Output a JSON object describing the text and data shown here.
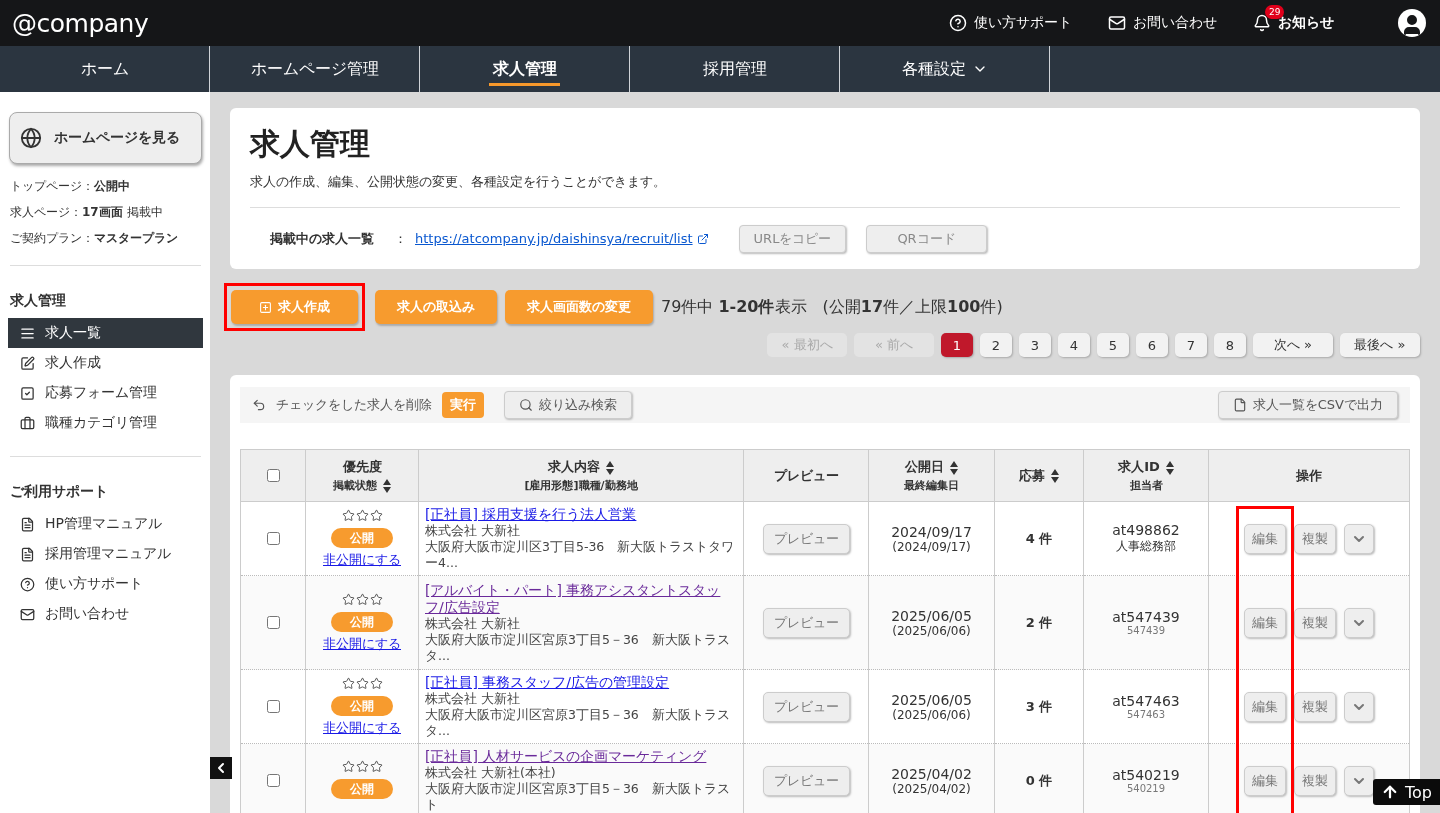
{
  "header": {
    "logo": "@company",
    "links": [
      {
        "kind": "help",
        "label": "使い方サポート"
      },
      {
        "kind": "mail",
        "label": "お問い合わせ"
      },
      {
        "kind": "bell",
        "label": "お知らせ",
        "badge": "29"
      }
    ]
  },
  "nav": [
    {
      "label": "ホーム",
      "selected": false,
      "dropdown": false
    },
    {
      "label": "ホームページ管理",
      "selected": false,
      "dropdown": false
    },
    {
      "label": "求人管理",
      "selected": true,
      "dropdown": false
    },
    {
      "label": "採用管理",
      "selected": false,
      "dropdown": false
    },
    {
      "label": "各種設定",
      "selected": false,
      "dropdown": true
    }
  ],
  "sidebar": {
    "view_button": "ホームページを見る",
    "info": [
      {
        "label": "トップページ：",
        "value": "**公開中**"
      },
      {
        "label": "求人ページ：",
        "value": "**17画面** 掲載中"
      },
      {
        "label": "ご契約プラン：",
        "value": "**マスタープラン**"
      }
    ],
    "sections": [
      {
        "title": "求人管理",
        "items": [
          {
            "kind": "list",
            "label": "求人一覧",
            "selected": true
          },
          {
            "kind": "edit",
            "label": "求人作成",
            "selected": false
          },
          {
            "kind": "check",
            "label": "応募フォーム管理",
            "selected": false
          },
          {
            "kind": "briefcase",
            "label": "職種カテゴリ管理",
            "selected": false
          }
        ]
      },
      {
        "title": "ご利用サポート",
        "items": [
          {
            "kind": "pdf",
            "label": "HP管理マニュアル",
            "selected": false
          },
          {
            "kind": "pdf",
            "label": "採用管理マニュアル",
            "selected": false
          },
          {
            "kind": "help",
            "label": "使い方サポート",
            "selected": false
          },
          {
            "kind": "mail",
            "label": "お問い合わせ",
            "selected": false
          }
        ]
      }
    ]
  },
  "page": {
    "title": "求人管理",
    "description": "求人の作成、編集、公開状態の変更、各種設定を行うことができます。",
    "list_label": "掲載中の求人一覧",
    "list_separator": "：",
    "list_url": "https://atcompany.jp/daishinsya/recruit/list",
    "copy_button": "URLをコピー",
    "qr_button": "QRコード"
  },
  "actions": [
    {
      "label": "求人作成",
      "plus": true,
      "highlighted": true
    },
    {
      "label": "求人の取込み",
      "plus": false,
      "highlighted": false
    },
    {
      "label": "求人画面数の変更",
      "plus": false,
      "highlighted": false
    }
  ],
  "summary": "79件中 **1-20件**表示　(公開**17**件／上限**100**件)",
  "pagination": [
    {
      "label": "« 最初へ",
      "disabled": true,
      "selected": false
    },
    {
      "label": "« 前へ",
      "disabled": true,
      "selected": false
    },
    {
      "label": "1",
      "disabled": false,
      "selected": true
    },
    {
      "label": "2",
      "disabled": false,
      "selected": false
    },
    {
      "label": "3",
      "disabled": false,
      "selected": false
    },
    {
      "label": "4",
      "disabled": false,
      "selected": false
    },
    {
      "label": "5",
      "disabled": false,
      "selected": false
    },
    {
      "label": "6",
      "disabled": false,
      "selected": false
    },
    {
      "label": "7",
      "disabled": false,
      "selected": false
    },
    {
      "label": "8",
      "disabled": false,
      "selected": false
    },
    {
      "label": "次へ »",
      "disabled": false,
      "selected": false
    },
    {
      "label": "最後へ »",
      "disabled": false,
      "selected": false
    }
  ],
  "table_toolbar": {
    "delete_label": "チェックをした求人を削除",
    "run_button": "実行",
    "filter_button": "絞り込み検索",
    "csv_button": "求人一覧をCSVで出力"
  },
  "table": {
    "select_all": false,
    "highlight_edit_column": true,
    "columns": [
      {
        "label": "優先度",
        "sub": "掲載状態",
        "sortable": true
      },
      {
        "label": "求人内容",
        "sub": "[雇用形態]職種/勤務地",
        "sortable": true
      },
      {
        "label": "プレビュー",
        "sortable": false
      },
      {
        "label": "公開日",
        "sub": "最終編集日",
        "sortable": true
      },
      {
        "label": "応募",
        "sortable": true
      },
      {
        "label": "求人ID",
        "sub": "担当者",
        "sortable": true
      },
      {
        "label": "操作",
        "sortable": false
      }
    ],
    "rows": [
      {
        "checked": false,
        "stars": 0,
        "status": "公開",
        "unpublish": "非公開にする",
        "title": "[正社員] 採用支援を行う法人営業",
        "visited": false,
        "company": "株式会社 大新社",
        "address": "大阪府大阪市淀川区3丁目5-36　新大阪トラストタワー4...",
        "preview": "プレビュー",
        "date": "2024/09/17",
        "edited": "(2024/09/17)",
        "applications": "4 件",
        "id": "at498862",
        "owner": "人事総務部",
        "owner_small": false,
        "edit": "編集",
        "copy": "複製"
      },
      {
        "checked": false,
        "stars": 0,
        "status": "公開",
        "unpublish": "非公開にする",
        "title": "[アルバイト・パート] 事務アシスタントスタッフ/広告設定",
        "visited": true,
        "company": "株式会社 大新社",
        "address": "大阪府大阪市淀川区宮原3丁目5－36　新大阪トラスタ...",
        "preview": "プレビュー",
        "date": "2025/06/05",
        "edited": "(2025/06/06)",
        "applications": "2 件",
        "id": "at547439",
        "owner": "547439",
        "owner_small": true,
        "edit": "編集",
        "copy": "複製"
      },
      {
        "checked": false,
        "stars": 0,
        "status": "公開",
        "unpublish": "非公開にする",
        "title": "[正社員] 事務スタッフ/広告の管理設定",
        "visited": false,
        "company": "株式会社 大新社",
        "address": "大阪府大阪市淀川区宮原3丁目5－36　新大阪トラスタ...",
        "preview": "プレビュー",
        "date": "2025/06/05",
        "edited": "(2025/06/06)",
        "applications": "3 件",
        "id": "at547463",
        "owner": "547463",
        "owner_small": true,
        "edit": "編集",
        "copy": "複製"
      },
      {
        "checked": false,
        "stars": 0,
        "status": "公開",
        "title": "[正社員] 人材サービスの企画マーケティング",
        "visited": true,
        "company": "株式会社 大新社(本社)",
        "address": "大阪府大阪市淀川区宮原3丁目5－36　新大阪トラスト",
        "preview": "プレビュー",
        "date": "2025/04/02",
        "edited": "(2025/04/02)",
        "applications": "0 件",
        "id": "at540219",
        "owner": "540219",
        "owner_small": true,
        "edit": "編集",
        "copy": "複製"
      }
    ]
  },
  "top_button": "Top"
}
